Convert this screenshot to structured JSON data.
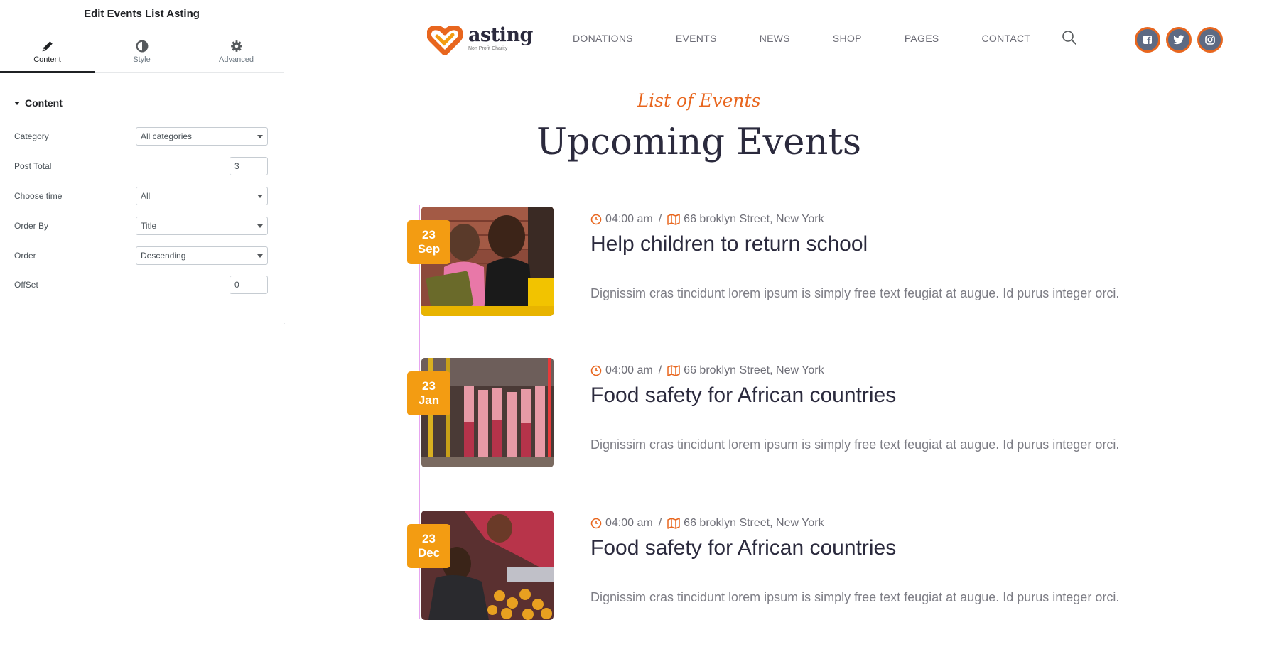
{
  "panel": {
    "title": "Edit Events List Asting",
    "tabs": [
      {
        "label": "Content",
        "icon": "pencil-icon",
        "active": true
      },
      {
        "label": "Style",
        "icon": "half-circle-icon",
        "active": false
      },
      {
        "label": "Advanced",
        "icon": "gear-icon",
        "active": false
      }
    ],
    "section": "Content",
    "controls": {
      "category": {
        "label": "Category",
        "value": "All categories"
      },
      "post_total": {
        "label": "Post Total",
        "value": "3"
      },
      "choose_time": {
        "label": "Choose time",
        "value": "All"
      },
      "order_by": {
        "label": "Order By",
        "value": "Title"
      },
      "order": {
        "label": "Order",
        "value": "Descending"
      },
      "offset": {
        "label": "OffSet",
        "value": "0"
      }
    },
    "collapse_glyph": "‹"
  },
  "site": {
    "logo": {
      "word": "asting",
      "tagline": "Non Profit Charity"
    },
    "nav": [
      "DONATIONS",
      "EVENTS",
      "NEWS",
      "SHOP",
      "PAGES",
      "CONTACT"
    ],
    "social": [
      "facebook-icon",
      "twitter-icon",
      "instagram-icon"
    ],
    "subtitle": "List of Events",
    "title": "Upcoming Events",
    "colors": {
      "accent": "#e8661e",
      "badge": "#f39c12",
      "heading": "#2b2a3d",
      "social_bg": "#5d6a83"
    },
    "events": [
      {
        "day": "23",
        "month": "Sep",
        "time": "04:00 am",
        "location": "66 broklyn Street, New York",
        "title": "Help children to return school",
        "desc": "Dignissim cras tincidunt lorem ipsum is simply free text feugiat at augue. Id purus integer orci."
      },
      {
        "day": "23",
        "month": "Jan",
        "time": "04:00 am",
        "location": "66 broklyn Street, New York",
        "title": "Food safety for African countries",
        "desc": "Dignissim cras tincidunt lorem ipsum is simply free text feugiat at augue. Id purus integer orci."
      },
      {
        "day": "23",
        "month": "Dec",
        "time": "04:00 am",
        "location": "66 broklyn Street, New York",
        "title": "Food safety for African countries",
        "desc": "Dignissim cras tincidunt lorem ipsum is simply free text feugiat at augue. Id purus integer orci."
      }
    ]
  }
}
